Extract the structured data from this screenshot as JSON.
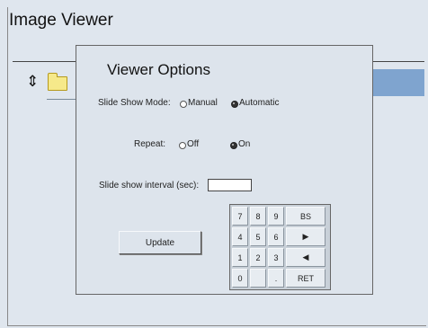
{
  "app": {
    "title": "Image Viewer"
  },
  "browser": {
    "updown_glyph": "⇕"
  },
  "dialog": {
    "title": "Viewer Options",
    "slide_show_mode": {
      "label": "Slide Show Mode:",
      "options": [
        "Manual",
        "Automatic"
      ],
      "selected": "Automatic"
    },
    "repeat": {
      "label": "Repeat:",
      "options": [
        "Off",
        "On"
      ],
      "selected": "On"
    },
    "interval": {
      "label": "Slide show interval (sec):",
      "value": ""
    },
    "update_label": "Update",
    "keypad": [
      "7",
      "8",
      "9",
      "BS",
      "4",
      "5",
      "6",
      "▶",
      "1",
      "2",
      "3",
      "◀",
      "0",
      "",
      ".",
      "RET"
    ]
  }
}
